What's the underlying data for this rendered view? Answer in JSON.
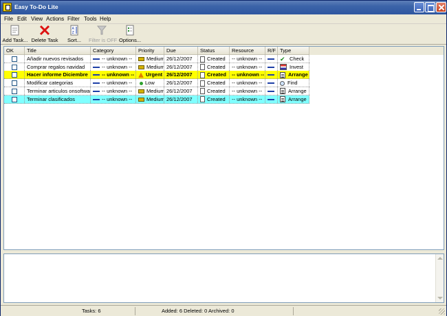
{
  "window": {
    "title": "Easy To-Do Lite"
  },
  "menu": [
    "File",
    "Edit",
    "View",
    "Actions",
    "Filter",
    "Tools",
    "Help"
  ],
  "toolbar": {
    "add": "Add Task...",
    "delete": "Delete Task",
    "sort": "Sort...",
    "filter": "Filter is OFF",
    "options": "Options..."
  },
  "columns": [
    "OK",
    "Title",
    "Category",
    "Priority",
    "Due",
    "Status",
    "Resource",
    "R/F",
    "Type"
  ],
  "tasks": [
    {
      "title": "Añadir nuevos revisados",
      "category": "-- unknown --",
      "priority": "Medium",
      "priority_icon": "medium",
      "due": "26/12/2007",
      "status": "Created",
      "resource": "-- unknown --",
      "type": "Check",
      "type_icon": "check-icon",
      "highlight": ""
    },
    {
      "title": "Comprar regalos navidad",
      "category": "-- unknown --",
      "priority": "Medium",
      "priority_icon": "medium",
      "due": "26/12/2007",
      "status": "Created",
      "resource": "-- unknown --",
      "type": "Invest",
      "type_icon": "invest-icon",
      "highlight": ""
    },
    {
      "title": "Hacer informe Diciembre",
      "category": "-- unknown --",
      "priority": "Urgent",
      "priority_icon": "urgent",
      "due": "26/12/2007",
      "status": "Created",
      "resource": "-- unknown --",
      "type": "Arrange",
      "type_icon": "arrange-icon",
      "highlight": "#ffff00"
    },
    {
      "title": "Modificar categorias",
      "category": "-- unknown --",
      "priority": "Low",
      "priority_icon": "low",
      "due": "26/12/2007",
      "status": "Created",
      "resource": "-- unknown --",
      "type": "Find",
      "type_icon": "find-icon",
      "highlight": ""
    },
    {
      "title": "Terminar articulos onsoftware",
      "category": "-- unknown --",
      "priority": "Medium",
      "priority_icon": "medium",
      "due": "26/12/2007",
      "status": "Created",
      "resource": "-- unknown --",
      "type": "Arrange",
      "type_icon": "arrange-icon",
      "highlight": ""
    },
    {
      "title": "Terminar clasificados",
      "category": "-- unknown --",
      "priority": "Medium",
      "priority_icon": "medium",
      "due": "26/12/2007",
      "status": "Created",
      "resource": "-- unknown --",
      "type": "Arrange",
      "type_icon": "arrange-icon",
      "highlight": "#80ffff"
    }
  ],
  "statusbar": {
    "tasks": "Tasks: 6",
    "summary": "Added: 6 Deleted: 0 Archived: 0"
  }
}
